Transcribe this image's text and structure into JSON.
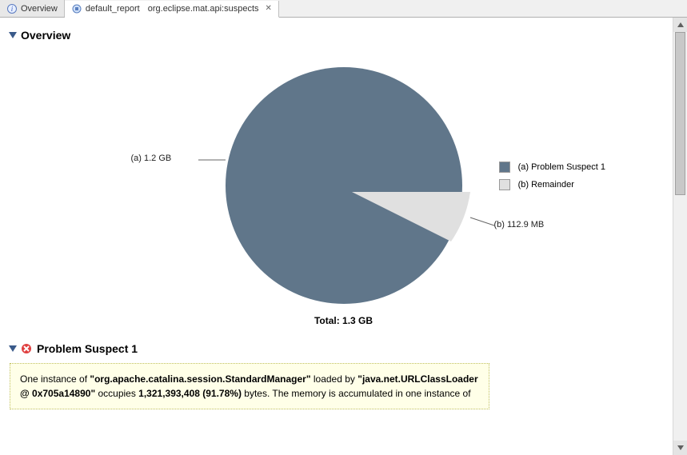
{
  "tabs": {
    "overview_label": "Overview",
    "report_label": "default_report",
    "suspects_label": "org.eclipse.mat.api:suspects"
  },
  "overview": {
    "heading": "Overview",
    "total_label": "Total: 1.3 GB",
    "slice_a_label": "(a) 1.2 GB",
    "slice_b_label": "(b) 112.9 MB",
    "legend_a": "(a)  Problem Suspect 1",
    "legend_b": "(b)  Remainder"
  },
  "problem": {
    "heading": "Problem Suspect 1",
    "text_1": "One instance of ",
    "bold_1": "\"org.apache.catalina.session.StandardManager\"",
    "text_2": " loaded by ",
    "bold_2": "\"java.net.URLClassLoader @ 0x705a14890\"",
    "text_3": " occupies ",
    "bold_3": "1,321,393,408 (91.78%)",
    "text_4": " bytes. The memory is accumulated in one instance of "
  },
  "colors": {
    "suspect": "#60768a",
    "remainder": "#e0e0e0"
  },
  "chart_data": {
    "type": "pie",
    "title": "Overview",
    "total": "1.3 GB",
    "series": [
      {
        "name": "(a) Problem Suspect 1",
        "label": "(a) 1.2 GB",
        "value_bytes": 1321393408,
        "value_display": "1.2 GB",
        "percent": 91.78,
        "color": "#60768a"
      },
      {
        "name": "(b) Remainder",
        "label": "(b) 112.9 MB",
        "value_bytes": 118380000,
        "value_display": "112.9 MB",
        "percent": 8.22,
        "color": "#e0e0e0"
      }
    ]
  }
}
